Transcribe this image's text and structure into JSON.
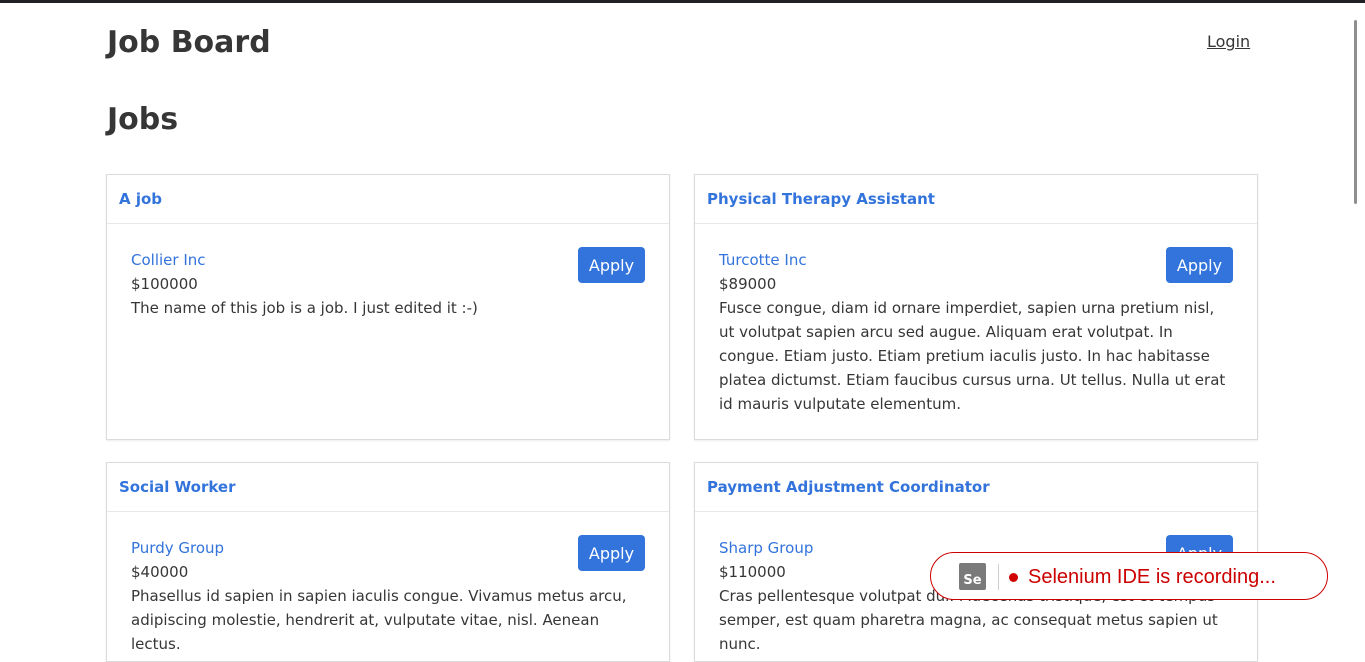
{
  "header": {
    "site_title": "Job Board",
    "login_label": "Login"
  },
  "page": {
    "title": "Jobs"
  },
  "jobs": [
    {
      "title": "A job",
      "company": "Collier Inc",
      "salary": "$100000",
      "description": "The name of this job is a job. I just edited it :-)",
      "apply_label": "Apply"
    },
    {
      "title": "Physical Therapy Assistant",
      "company": "Turcotte Inc",
      "salary": "$89000",
      "description": "Fusce congue, diam id ornare imperdiet, sapien urna pretium nisl, ut volutpat sapien arcu sed augue. Aliquam erat volutpat. In congue. Etiam justo. Etiam pretium iaculis justo. In hac habitasse platea dictumst. Etiam faucibus cursus urna. Ut tellus. Nulla ut erat id mauris vulputate elementum.",
      "apply_label": "Apply"
    },
    {
      "title": "Social Worker",
      "company": "Purdy Group",
      "salary": "$40000",
      "description": "Phasellus id sapien in sapien iaculis congue. Vivamus metus arcu, adipiscing molestie, hendrerit at, vulputate vitae, nisl. Aenean lectus.",
      "apply_label": "Apply"
    },
    {
      "title": "Payment Adjustment Coordinator",
      "company": "Sharp Group",
      "salary": "$110000",
      "description": "Cras pellentesque volutpat dui. Maecenas tristique, est et tempus semper, est quam pharetra magna, ac consequat metus sapien ut nunc.",
      "apply_label": "Apply"
    }
  ],
  "recorder": {
    "logo_text": "Se",
    "status_text": "Selenium IDE is recording..."
  },
  "colors": {
    "link": "#3273dc",
    "text": "#363636",
    "recording": "#cc0000"
  }
}
